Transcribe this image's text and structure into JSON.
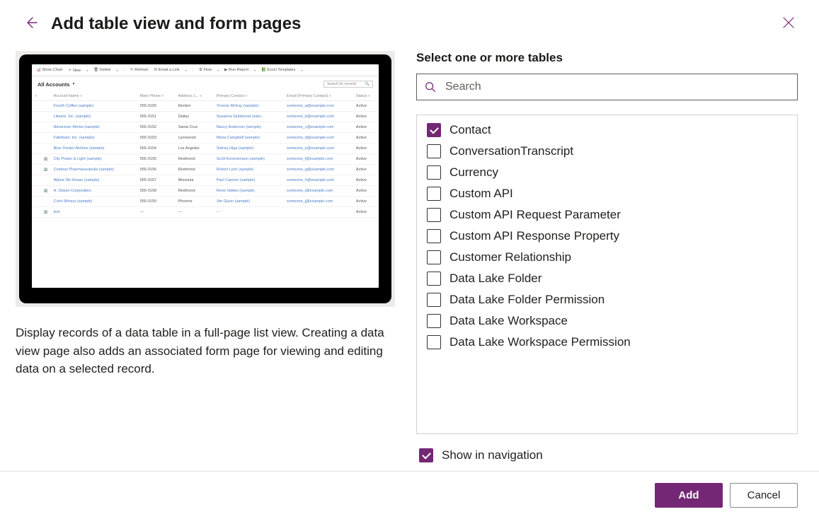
{
  "header": {
    "title": "Add table view and form pages"
  },
  "preview": {
    "toolbar": [
      "📊 Show Chart",
      "＋ New",
      "🗑 Delete",
      "↻ Refresh",
      "✉ Email a Link",
      "⚙ Flow",
      "▶ Run Report",
      "📗 Excel Templates"
    ],
    "view_title": "All Accounts",
    "search_placeholder": "Search for records",
    "columns": [
      "",
      "",
      "Account Name",
      "Main Phone",
      "Address 1...",
      "Primary Contact",
      "Email (Primary Contact)",
      "Status"
    ],
    "rows": [
      {
        "icon": "",
        "name": "Fourth Coffee (sample)",
        "phone": "555-0150",
        "city": "Renton",
        "contact": "Yvonne McKay (sample)",
        "email": "someone_a@example.com",
        "status": "Active"
      },
      {
        "icon": "",
        "name": "Litware, Inc. (sample)",
        "phone": "555-0151",
        "city": "Dallas",
        "contact": "Susanna Stubberod (sam...",
        "email": "someone_b@example.com",
        "status": "Active"
      },
      {
        "icon": "",
        "name": "Adventure Works (sample)",
        "phone": "555-0152",
        "city": "Santa Cruz",
        "contact": "Nancy Anderson (sample)",
        "email": "someone_c@example.com",
        "status": "Active"
      },
      {
        "icon": "",
        "name": "Fabrikam, Inc. (sample)",
        "phone": "555-0153",
        "city": "Lynnwood",
        "contact": "Maria Campbell (sample)",
        "email": "someone_d@example.com",
        "status": "Active"
      },
      {
        "icon": "",
        "name": "Blue Yonder Airlines (sample)",
        "phone": "555-0154",
        "city": "Los Angeles",
        "contact": "Sidney Higa (sample)",
        "email": "someone_e@example.com",
        "status": "Active"
      },
      {
        "icon": "🏢",
        "name": "City Power & Light (sample)",
        "phone": "555-0155",
        "city": "Redmond",
        "contact": "Scott Konersmann (sample)",
        "email": "someone_f@example.com",
        "status": "Active"
      },
      {
        "icon": "🏢",
        "name": "Contoso Pharmaceuticals (sample)",
        "phone": "555-0156",
        "city": "Redmond",
        "contact": "Robert Lyon (sample)",
        "email": "someone_g@example.com",
        "status": "Active"
      },
      {
        "icon": "",
        "name": "Alpine Ski House (sample)",
        "phone": "555-0157",
        "city": "Missoula",
        "contact": "Paul Cannon (sample)",
        "email": "someone_h@example.com",
        "status": "Active"
      },
      {
        "icon": "🏢",
        "name": "A. Datum Corporation",
        "phone": "555-0158",
        "city": "Redmond",
        "contact": "Rene Valdes (sample)",
        "email": "someone_i@example.com",
        "status": "Active"
      },
      {
        "icon": "",
        "name": "Coho Winery (sample)",
        "phone": "555-0159",
        "city": "Phoenix",
        "contact": "Jim Glynn (sample)",
        "email": "someone_j@example.com",
        "status": "Active"
      },
      {
        "icon": "🏢",
        "name": "test",
        "phone": "---",
        "city": "---",
        "contact": "---",
        "email": "",
        "status": "Active"
      }
    ]
  },
  "description": "Display records of a data table in a full-page list view. Creating a data view page also adds an associated form page for viewing and editing data on a selected record.",
  "right": {
    "section_label": "Select one or more tables",
    "search_placeholder": "Search",
    "tables": [
      {
        "label": "Contact",
        "checked": true
      },
      {
        "label": "ConversationTranscript",
        "checked": false
      },
      {
        "label": "Currency",
        "checked": false
      },
      {
        "label": "Custom API",
        "checked": false
      },
      {
        "label": "Custom API Request Parameter",
        "checked": false
      },
      {
        "label": "Custom API Response Property",
        "checked": false
      },
      {
        "label": "Customer Relationship",
        "checked": false
      },
      {
        "label": "Data Lake Folder",
        "checked": false
      },
      {
        "label": "Data Lake Folder Permission",
        "checked": false
      },
      {
        "label": "Data Lake Workspace",
        "checked": false
      },
      {
        "label": "Data Lake Workspace Permission",
        "checked": false
      }
    ],
    "show_in_nav_label": "Show in navigation",
    "show_in_nav_checked": true
  },
  "footer": {
    "primary": "Add",
    "secondary": "Cancel"
  }
}
